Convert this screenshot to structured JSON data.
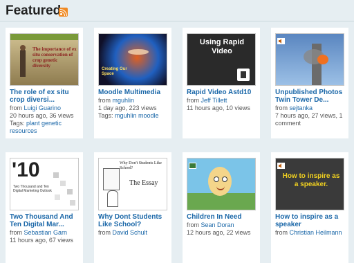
{
  "section": {
    "title": "Featured"
  },
  "row1": [
    {
      "title": "The role of ex situ crop diversi...",
      "from_prefix": "from ",
      "author": "Luigi Guarino",
      "stats": "20 hours ago, 36 views",
      "tags_prefix": "Tags: ",
      "tags": "plant genetic resources",
      "thumb_text": "The importance of ex situ conservation of crop genetic diversity"
    },
    {
      "title": "Moodle Multimedia",
      "from_prefix": "from ",
      "author": "mguhlin",
      "stats": "1 day ago, 223 views",
      "tags_prefix": "Tags: ",
      "tags": "mguhlin moodle",
      "thumb_text": "Creating Our Space"
    },
    {
      "title": "Rapid Video Astd10",
      "from_prefix": "from ",
      "author": "Jeff Tillett",
      "stats": "11 hours ago, 10 views",
      "thumb_text": "Using Rapid Video"
    },
    {
      "title": "Unpublished Photos Twin Tower De...",
      "from_prefix": "from ",
      "author": "sejtanka",
      "stats": "7 hours ago, 27 views, 1 comment"
    }
  ],
  "row2": [
    {
      "title": "Two Thousand And Ten Digital Mar...",
      "from_prefix": "from ",
      "author": "Sebastian Garn",
      "stats": "11 hours ago, 67 views",
      "thumb_big": "'10",
      "thumb_text": "Two Thousand and Ten Digital Marketing Outlook"
    },
    {
      "title": "Why Dont Students Like School?",
      "from_prefix": "from ",
      "author": "David Schult",
      "thumb_heading": "Why Don't Students Like School?",
      "thumb_text": "The Essay"
    },
    {
      "title": "Children In Need",
      "from_prefix": "from ",
      "author": "Sean Doran",
      "stats": "12 hours ago, 22 views"
    },
    {
      "title": "How to inspire as a speaker",
      "from_prefix": "from ",
      "author": "Christian Heilmann",
      "thumb_text": "How to inspire as a speaker."
    }
  ]
}
